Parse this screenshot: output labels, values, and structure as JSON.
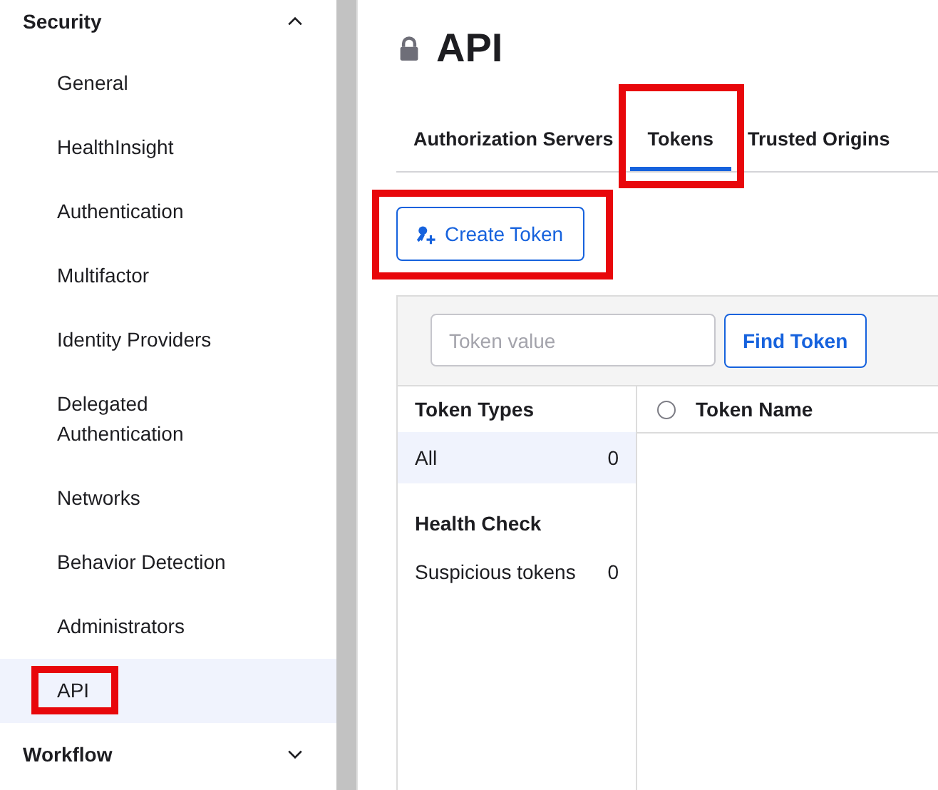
{
  "sidebar": {
    "sections": [
      {
        "title": "Security",
        "expanded": true,
        "items": [
          {
            "label": "General",
            "selected": false,
            "highlighted": false
          },
          {
            "label": "HealthInsight",
            "selected": false,
            "highlighted": false
          },
          {
            "label": "Authentication",
            "selected": false,
            "highlighted": false
          },
          {
            "label": "Multifactor",
            "selected": false,
            "highlighted": false
          },
          {
            "label": "Identity Providers",
            "selected": false,
            "highlighted": false
          },
          {
            "label": "Delegated Authentication",
            "selected": false,
            "highlighted": false
          },
          {
            "label": "Networks",
            "selected": false,
            "highlighted": false
          },
          {
            "label": "Behavior Detection",
            "selected": false,
            "highlighted": false
          },
          {
            "label": "Administrators",
            "selected": false,
            "highlighted": false
          },
          {
            "label": "API",
            "selected": true,
            "highlighted": true
          }
        ]
      },
      {
        "title": "Workflow",
        "expanded": false
      }
    ]
  },
  "page": {
    "title": "API",
    "tabs": [
      {
        "label": "Authorization Servers",
        "selected": false,
        "highlighted": false
      },
      {
        "label": "Tokens",
        "selected": true,
        "highlighted": true
      },
      {
        "label": "Trusted Origins",
        "selected": false,
        "highlighted": false
      }
    ],
    "create_button": {
      "label": "Create Token",
      "highlighted": true
    },
    "search": {
      "placeholder": "Token value",
      "button": "Find Token"
    },
    "filters": [
      {
        "kind": "heading",
        "label": "Token Types"
      },
      {
        "kind": "option",
        "label": "All",
        "count": "0",
        "selected": true
      },
      {
        "kind": "heading",
        "label": "Health Check"
      },
      {
        "kind": "option",
        "label": "Suspicious tokens",
        "count": "0",
        "selected": false
      }
    ],
    "table": {
      "select_all_checked": false,
      "columns": [
        "Token Name"
      ]
    }
  }
}
